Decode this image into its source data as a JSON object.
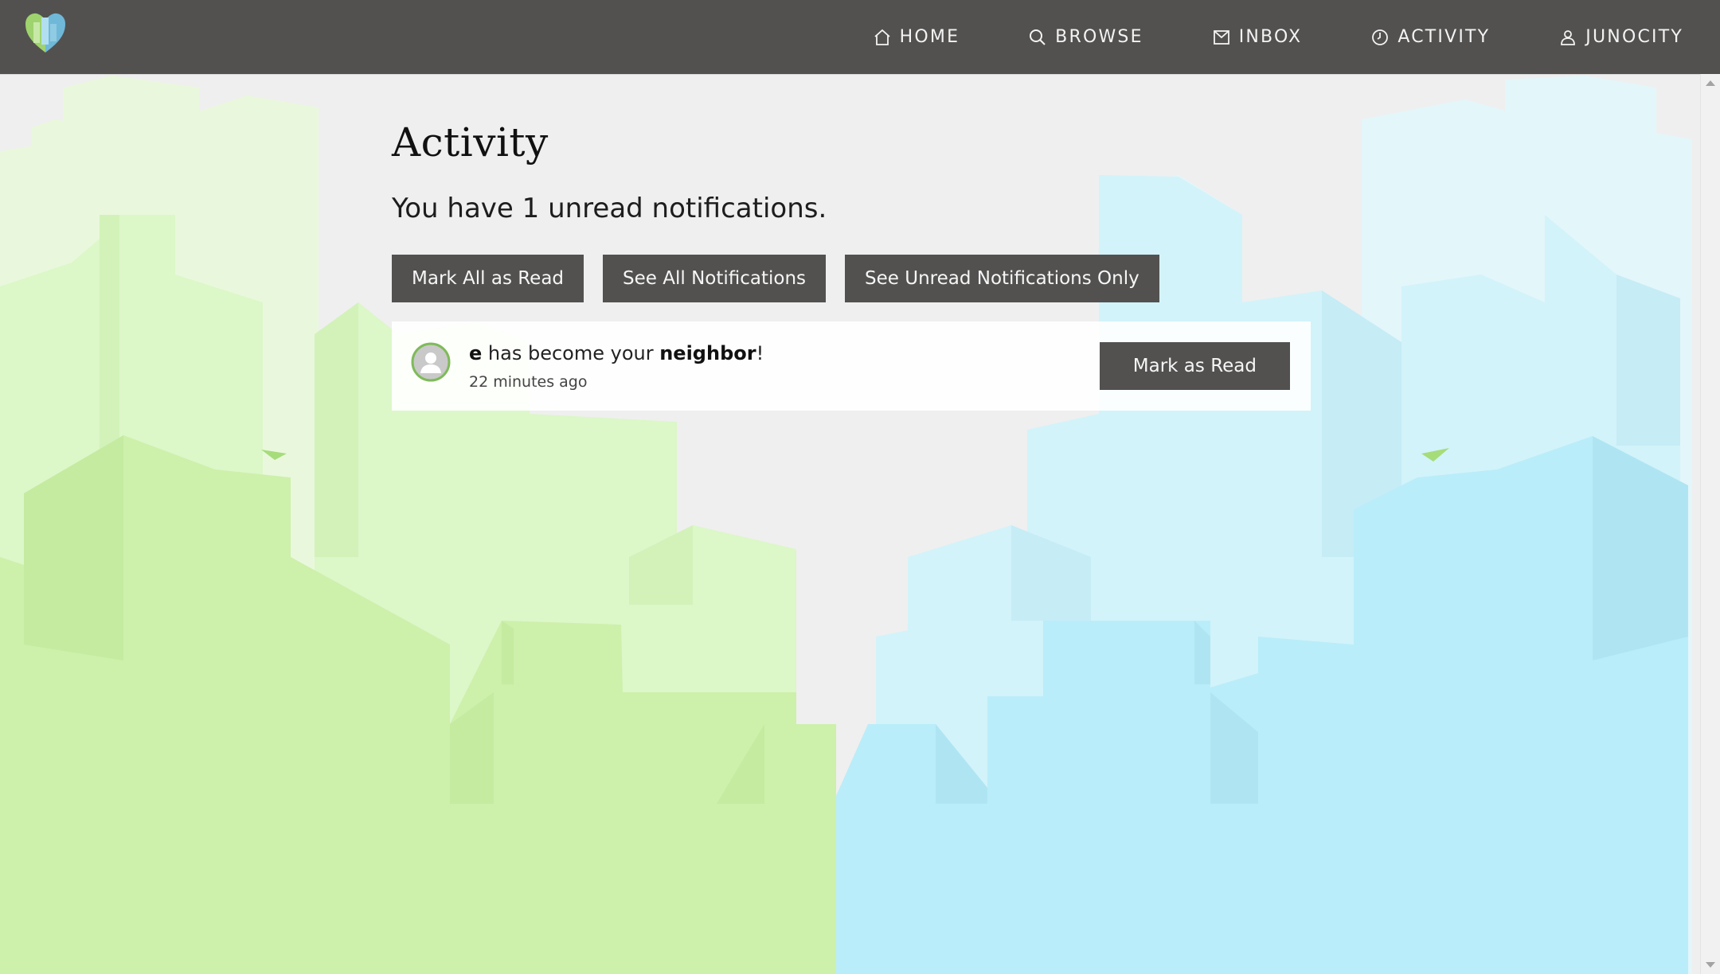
{
  "nav": {
    "items": [
      {
        "label": "HOME",
        "icon": "home-icon"
      },
      {
        "label": "BROWSE",
        "icon": "search-icon"
      },
      {
        "label": "INBOX",
        "icon": "mail-icon"
      },
      {
        "label": "ACTIVITY",
        "icon": "clock-icon"
      },
      {
        "label": "JUNOCITY",
        "icon": "user-icon"
      }
    ]
  },
  "page": {
    "title": "Activity",
    "summary": "You have 1 unread notifications."
  },
  "actions": {
    "mark_all_read": "Mark All as Read",
    "see_all": "See All Notifications",
    "see_unread": "See Unread Notifications Only"
  },
  "notifications": [
    {
      "user": "e",
      "text": " has become your ",
      "relation": "neighbor",
      "suffix": "!",
      "time": "22 minutes ago",
      "button": "Mark as Read"
    }
  ],
  "colors": {
    "navbar": "#525150",
    "button": "#525150",
    "page_bg": "#efefef",
    "green_skyline": "#cdf0ab",
    "blue_skyline": "#b8ecf8"
  }
}
